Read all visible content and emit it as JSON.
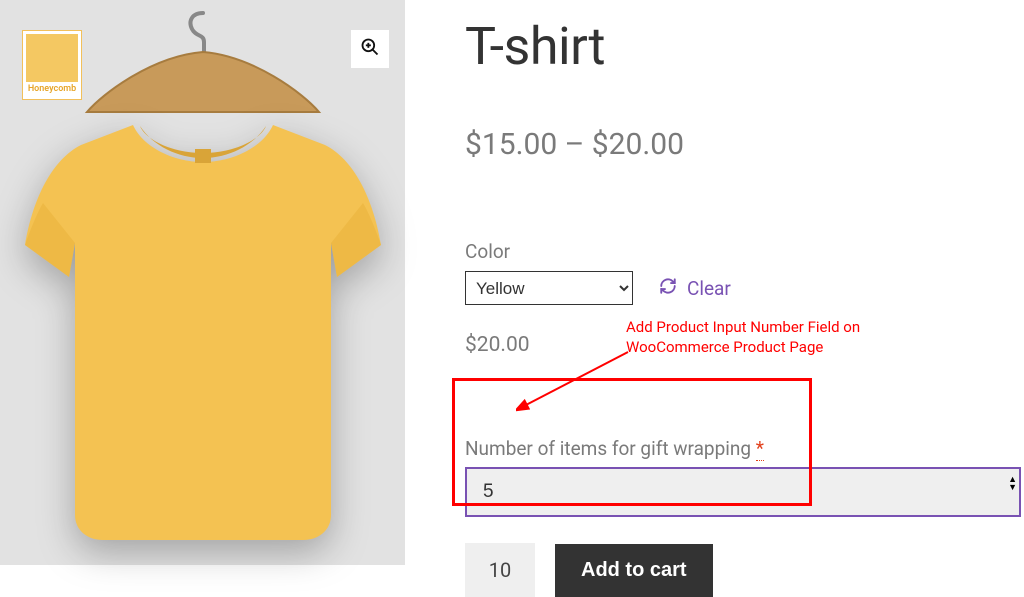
{
  "swatch": {
    "label": "Honeycomb"
  },
  "product": {
    "title": "T-shirt",
    "price_range": "$15.00 – $20.00"
  },
  "variation": {
    "label": "Color",
    "selected": "Yellow",
    "price": "$20.00"
  },
  "clear_label": "Clear",
  "gift_wrap": {
    "label": "Number of items for gift wrapping ",
    "required_mark": "*",
    "value": "5"
  },
  "cart": {
    "qty": "10",
    "button": "Add to cart"
  },
  "annotation": {
    "line1": "Add Product Input Number Field on",
    "line2": "WooCommerce Product Page"
  }
}
